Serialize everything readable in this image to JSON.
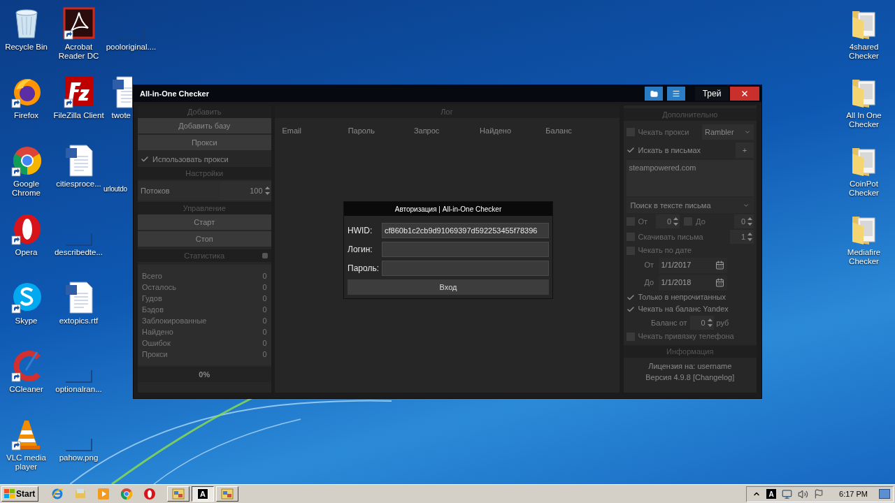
{
  "desktop": {
    "icons": [
      {
        "label": "Recycle Bin",
        "kind": "recycle"
      },
      {
        "label": "Firefox",
        "kind": "firefox"
      },
      {
        "label": "Google Chrome",
        "kind": "chrome"
      },
      {
        "label": "Opera",
        "kind": "opera"
      },
      {
        "label": "Skype",
        "kind": "skype"
      },
      {
        "label": "CCleaner",
        "kind": "ccleaner"
      },
      {
        "label": "VLC media player",
        "kind": "vlc"
      },
      {
        "label": "Acrobat Reader DC",
        "kind": "pdf"
      },
      {
        "label": "FileZilla Client",
        "kind": "filezilla"
      },
      {
        "label": "citiesproce...",
        "kind": "word"
      },
      {
        "label": "describedte...",
        "kind": "blank"
      },
      {
        "label": "extopics.rtf",
        "kind": "word"
      },
      {
        "label": "optionalran...",
        "kind": "blank"
      },
      {
        "label": "pahow.png",
        "kind": "blank"
      },
      {
        "label": "pooloriginal....",
        "kind": "blank"
      }
    ],
    "partial_icons": [
      {
        "label": "twote",
        "kind": "word"
      },
      {
        "label": "urloutdo",
        "kind": "none"
      }
    ],
    "right_icons": [
      {
        "label": "4shared Checker",
        "kind": "folder"
      },
      {
        "label": "All In One Checker",
        "kind": "folder"
      },
      {
        "label": "CoinPot Checker",
        "kind": "folder"
      },
      {
        "label": "Mediafire Checker",
        "kind": "folder"
      }
    ]
  },
  "window": {
    "title": "All-in-One Checker",
    "title_buttons": [
      {
        "kind": "folder"
      },
      {
        "kind": "menu"
      },
      {
        "kind": "text",
        "label": "Трей"
      },
      {
        "kind": "close"
      }
    ]
  },
  "left_panel": {
    "items": [
      {
        "kind": "header",
        "label": "Добавить"
      },
      {
        "kind": "button",
        "label": "Добавить базу"
      },
      {
        "kind": "button",
        "label": "Прокси"
      },
      {
        "kind": "checkbox",
        "label": "Использовать прокси",
        "checked": true
      },
      {
        "kind": "header",
        "label": "Настройки"
      },
      {
        "kind": "spinner",
        "label": "Потоков",
        "value": "100"
      },
      {
        "kind": "header",
        "label": "Управление"
      },
      {
        "kind": "button",
        "label": "Старт"
      },
      {
        "kind": "button",
        "label": "Стоп"
      },
      {
        "kind": "header_icon",
        "label": "Статистика"
      },
      {
        "kind": "stats",
        "rows": [
          {
            "label": "Всего",
            "value": "0"
          },
          {
            "label": "Осталось",
            "value": "0"
          },
          {
            "label": "Гудов",
            "value": "0"
          },
          {
            "label": "Бэдов",
            "value": "0"
          },
          {
            "label": "Заблокированные",
            "value": "0"
          },
          {
            "label": "Найдено",
            "value": "0"
          },
          {
            "label": "Ошибок",
            "value": "0"
          },
          {
            "label": "Прокси",
            "value": "0"
          }
        ]
      },
      {
        "kind": "progress",
        "label": "0%",
        "level": 0
      }
    ]
  },
  "log": {
    "title": "Лог",
    "columns": [
      "Email",
      "Пароль",
      "Запрос",
      "Найдено",
      "Баланс"
    ]
  },
  "right_panel": {
    "items": [
      {
        "kind": "header",
        "label": "Дополнительно"
      },
      {
        "kind": "checkbox_select",
        "label": "Чекать прокси",
        "checked": false,
        "value": "Rambler"
      },
      {
        "kind": "checkbox_button",
        "label": "Искать в письмах",
        "checked": true,
        "button": "+"
      },
      {
        "kind": "textarea",
        "value": "steampowered.com"
      },
      {
        "kind": "select",
        "value": "Поиск в тексте письма"
      },
      {
        "kind": "range",
        "from": {
          "label": "От",
          "checked": false,
          "value": "0"
        },
        "to": {
          "label": "До",
          "checked": false,
          "value": "0"
        }
      },
      {
        "kind": "checkbox_spinner",
        "label": "Скачивать письма",
        "checked": false,
        "value": "1"
      },
      {
        "kind": "checkbox",
        "label": "Чекать по дате",
        "checked": false
      },
      {
        "kind": "date",
        "label": "От",
        "value": "1/1/2017"
      },
      {
        "kind": "date",
        "label": "До",
        "value": "1/1/2018"
      },
      {
        "kind": "checkbox",
        "label": "Только в непрочитанных",
        "checked": true
      },
      {
        "kind": "checkbox",
        "label": "Чекать на баланс Yandex",
        "checked": true
      },
      {
        "kind": "balance",
        "label": "Баланс от",
        "value": "0",
        "unit": "руб"
      },
      {
        "kind": "checkbox",
        "label": "Чекать привязку телефона",
        "checked": false
      },
      {
        "kind": "header",
        "label": "Информация"
      },
      {
        "kind": "text",
        "label": "Лицензия на: username"
      },
      {
        "kind": "text",
        "label": "Версия 4.9.8 [Changelog]"
      }
    ]
  },
  "dialog": {
    "title": "Авторизация | All-in-One Checker",
    "fields": [
      {
        "label": "HWID:",
        "value": "cf860b1c2cb9d91069397d592253455f78396"
      },
      {
        "label": "Логин:"
      },
      {
        "label": "Пароль:"
      }
    ],
    "button": "Вход"
  },
  "taskbar": {
    "start": "Start",
    "quick_launch": [
      {
        "kind": "ie"
      },
      {
        "kind": "explorer"
      },
      {
        "kind": "media"
      },
      {
        "kind": "chrome"
      },
      {
        "kind": "opera"
      }
    ],
    "tasks": [
      {
        "kind": "app",
        "selected": false
      },
      {
        "kind": "letter",
        "glyph": "A",
        "selected": true
      },
      {
        "kind": "app",
        "selected": false
      }
    ],
    "tray": [
      {
        "kind": "chevron"
      },
      {
        "kind": "letter",
        "glyph": "A"
      },
      {
        "kind": "network"
      },
      {
        "kind": "volume"
      },
      {
        "kind": "flag"
      }
    ],
    "clock": "6:17 PM"
  }
}
